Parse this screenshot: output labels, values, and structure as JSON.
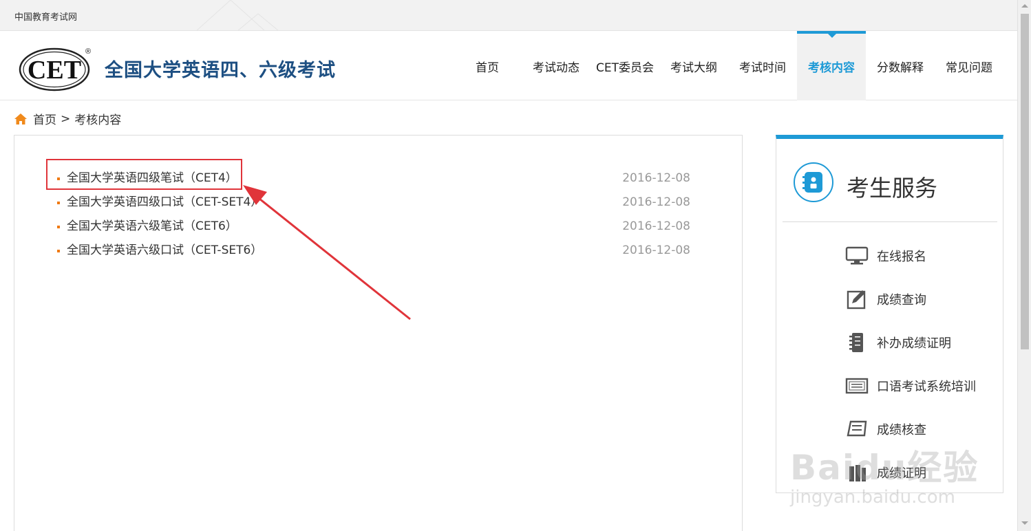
{
  "topbar": {
    "site_name": "中国教育考试网"
  },
  "header": {
    "logo_text": "CET",
    "logo_mark": "®",
    "title": "全国大学英语四、六级考试",
    "nav": [
      {
        "label": "首页"
      },
      {
        "label": "考试动态"
      },
      {
        "label": "CET委员会"
      },
      {
        "label": "考试大纲"
      },
      {
        "label": "考试时间"
      },
      {
        "label": "考核内容",
        "active": true
      },
      {
        "label": "分数解释"
      },
      {
        "label": "常见问题"
      }
    ],
    "accent_color": "#1e9ad6"
  },
  "breadcrumb": {
    "home": "首页",
    "separator": ">",
    "current": "考核内容"
  },
  "list": {
    "items": [
      {
        "title": "全国大学英语四级笔试（CET4）",
        "date": "2016-12-08"
      },
      {
        "title": "全国大学英语四级口试（CET-SET4）",
        "date": "2016-12-08"
      },
      {
        "title": "全国大学英语六级笔试（CET6）",
        "date": "2016-12-08"
      },
      {
        "title": "全国大学英语六级口试（CET-SET6）",
        "date": "2016-12-08"
      }
    ]
  },
  "sidebar": {
    "title": "考生服务",
    "items": [
      {
        "label": "在线报名",
        "icon": "monitor-icon"
      },
      {
        "label": "成绩查询",
        "icon": "edit-icon"
      },
      {
        "label": "补办成绩证明",
        "icon": "notebook-icon"
      },
      {
        "label": "口语考试系统培训",
        "icon": "certificate-icon"
      },
      {
        "label": "成绩核查",
        "icon": "book-icon"
      },
      {
        "label": "成绩证明",
        "icon": "books-icon"
      }
    ]
  },
  "watermark": {
    "line1": "Baidu经验",
    "line2": "jingyan.baidu.com"
  }
}
